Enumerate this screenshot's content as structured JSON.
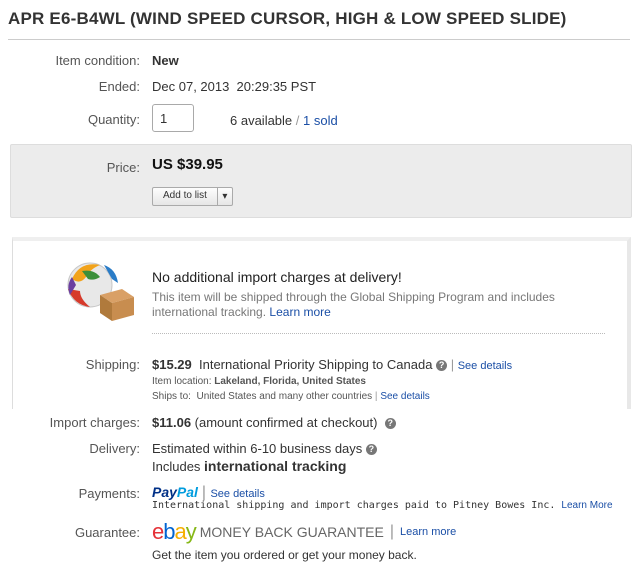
{
  "item": {
    "title": "APR E6-B4WL (WIND SPEED CURSOR, HIGH & LOW SPEED SLIDE)"
  },
  "condition": {
    "label": "Item condition:",
    "value": "New"
  },
  "ended": {
    "label": "Ended:",
    "value": "Dec 07, 2013  20:29:35 PST"
  },
  "quantity": {
    "label": "Quantity:",
    "value": "1",
    "available": "6 available",
    "separator": "/",
    "sold_link": "1 sold"
  },
  "price": {
    "label": "Price:",
    "value": "US $39.95",
    "add_to_list": "Add to list",
    "dropdown_arrow": "▾"
  },
  "global_shipping": {
    "icon": "global-shipping-globe-box-icon",
    "headline": "No additional import charges at delivery!",
    "description": "This item will be shipped through the Global Shipping Program and includes international tracking.",
    "learn_more": "Learn more"
  },
  "shipping": {
    "label": "Shipping:",
    "cost": "$15.29",
    "service": "International Priority Shipping to Canada",
    "see_details": "See details",
    "location_label": "Item location:",
    "location_value": "Lakeland, Florida, United States",
    "ships_to_label": "Ships to:",
    "ships_to_value": "United States and many other countries",
    "ships_to_link": "See details"
  },
  "import_charges": {
    "label": "Import charges:",
    "cost": "$11.06",
    "note": "(amount confirmed at checkout)"
  },
  "delivery": {
    "label": "Delivery:",
    "estimate": "Estimated within 6-10 business days",
    "includes": "Includes",
    "tracking": "international tracking"
  },
  "payments": {
    "label": "Payments:",
    "logo_part1": "Pay",
    "logo_part2": "Pal",
    "see_details": "See details",
    "note": "International shipping and import charges paid to Pitney Bowes Inc.",
    "learn_more": "Learn More"
  },
  "guarantee": {
    "label": "Guarantee:",
    "logo_letters": [
      "e",
      "b",
      "a",
      "y"
    ],
    "logo_colors": [
      "#e53238",
      "#0064d2",
      "#f5af02",
      "#86b817"
    ],
    "mbg": "MONEY BACK GUARANTEE",
    "learn_more": "Learn more",
    "tagline": "Get the item you ordered or get your money back."
  },
  "colors": {
    "link": "#1b4fa6",
    "paypal_dark": "#003087",
    "paypal_light": "#009cde"
  }
}
